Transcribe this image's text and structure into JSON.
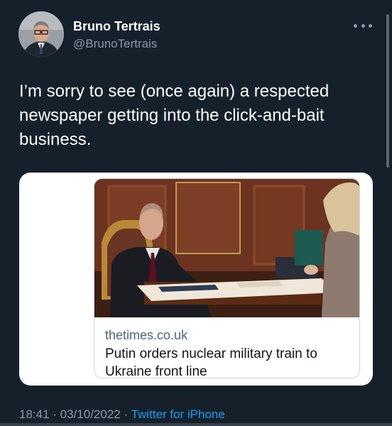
{
  "author": {
    "name": "Bruno Tertrais",
    "handle": "@BrunoTertrais",
    "avatar_icon": "profile-photo"
  },
  "tweet": {
    "text": "I’m sorry to see (once again) a respected newspaper getting into the click-and-bait business."
  },
  "card": {
    "domain": "thetimes.co.uk",
    "headline": "Putin orders nuclear military train to Ukraine front line",
    "image_icon": "news-photo"
  },
  "meta": {
    "time": "18:41",
    "separator": " · ",
    "date": "03/10/2022",
    "source": "Twitter for iPhone"
  },
  "colors": {
    "background": "#15202b",
    "secondary_text": "#8b98a5",
    "link": "#1d9bf0"
  }
}
